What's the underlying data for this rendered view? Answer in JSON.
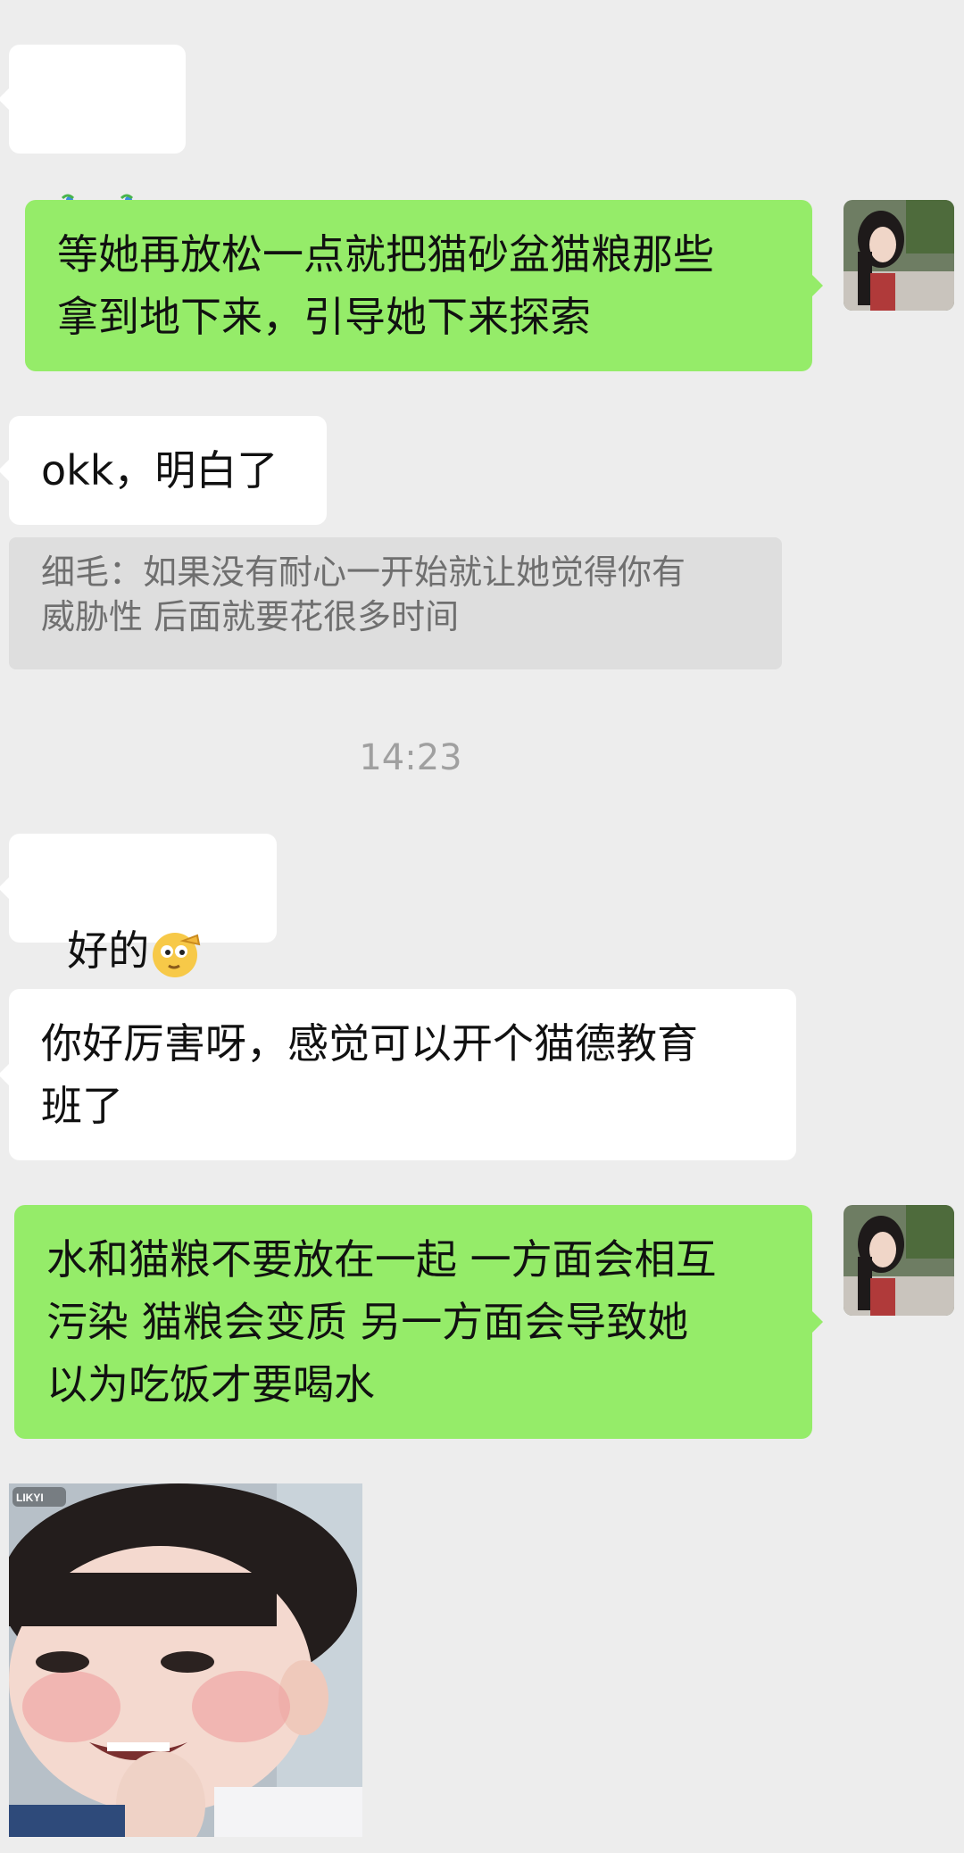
{
  "messages": {
    "m1": {
      "icon": "party-popper-icon"
    },
    "m2": {
      "text": "等她再放松一点就把猫砂盆猫粮那些\n拿到地下来，引导她下来探索"
    },
    "m3": {
      "text": "okk，明白了",
      "quote": "细毛：如果没有耐心一开始就让她觉得你有\n威胁性 后面就要花很多时间"
    },
    "timestamp": "14:23",
    "m4": {
      "text": "好的",
      "icon": "saluting-face-icon"
    },
    "m5": {
      "text": "你好厉害呀，感觉可以开个猫德教育\n班了"
    },
    "m6": {
      "text": "水和猫粮不要放在一起 一方面会相互\n污染 猫粮会变质 另一方面会导致她\n以为吃饭才要喝水"
    },
    "m7": {
      "image": "child-photo-sticker",
      "sticker_text": "LIKYI"
    }
  },
  "colors": {
    "background": "#ededed",
    "incoming_bubble": "#ffffff",
    "outgoing_bubble": "#95ec69",
    "quote_bg": "#dedede"
  }
}
